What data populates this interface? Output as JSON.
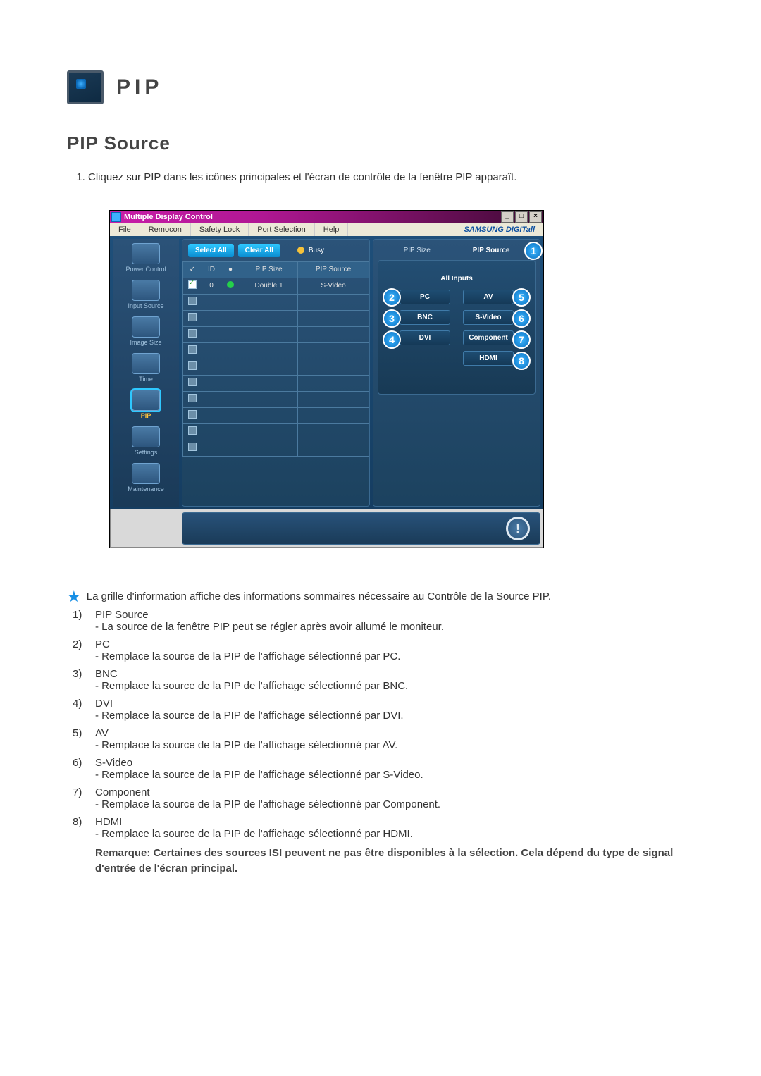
{
  "header": {
    "title": "PIP"
  },
  "section": {
    "subtitle": "PIP Source",
    "step1": "Cliquez sur PIP dans les icônes principales et l'écran de contrôle de la fenêtre PIP apparaît."
  },
  "app": {
    "title": "Multiple Display Control",
    "menus": [
      "File",
      "Remocon",
      "Safety Lock",
      "Port Selection",
      "Help"
    ],
    "brand": "SAMSUNG DIGITall",
    "sidebar": [
      {
        "label": "Power Control"
      },
      {
        "label": "Input Source"
      },
      {
        "label": "Image Size"
      },
      {
        "label": "Time"
      },
      {
        "label": "PIP"
      },
      {
        "label": "Settings"
      },
      {
        "label": "Maintenance"
      }
    ],
    "select_all": "Select All",
    "clear_all": "Clear All",
    "busy": "Busy",
    "grid_headers": {
      "chk": "✓",
      "id": "ID",
      "status": "●",
      "size": "PIP Size",
      "source": "PIP Source"
    },
    "grid_row0": {
      "id": "0",
      "size": "Double 1",
      "source": "S-Video"
    },
    "right": {
      "tab_size": "PIP Size",
      "tab_source": "PIP Source",
      "all_inputs": "All Inputs",
      "buttons": {
        "pc": "PC",
        "av": "AV",
        "bnc": "BNC",
        "svideo": "S-Video",
        "dvi": "DVI",
        "component": "Component",
        "hdmi": "HDMI"
      }
    },
    "info_icon": "!"
  },
  "star_line": "La grille d'information affiche des informations sommaires nécessaire au Contrôle de la Source PIP.",
  "items": [
    {
      "num": "1)",
      "label": "PIP Source",
      "body": "- La source de la fenêtre PIP peut se régler après avoir allumé le moniteur."
    },
    {
      "num": "2)",
      "label": "PC",
      "body": "- Remplace la source de la PIP de l'affichage sélectionné par PC."
    },
    {
      "num": "3)",
      "label": "BNC",
      "body": "- Remplace la source de la PIP de l'affichage sélectionné par BNC."
    },
    {
      "num": "4)",
      "label": "DVI",
      "body": "- Remplace la source de la PIP de l'affichage sélectionné par DVI."
    },
    {
      "num": "5)",
      "label": "AV",
      "body": "- Remplace la source de la PIP de l'affichage sélectionné par AV."
    },
    {
      "num": "6)",
      "label": "S-Video",
      "body": "- Remplace la source de la PIP de l'affichage sélectionné par S-Video."
    },
    {
      "num": "7)",
      "label": "Component",
      "body": "- Remplace la source de la PIP de l'affichage sélectionné par Component."
    },
    {
      "num": "8)",
      "label": "HDMI",
      "body": "- Remplace la source de la PIP de l'affichage sélectionné par HDMI."
    }
  ],
  "remark": "Remarque: Certaines des sources ISI peuvent ne pas être disponibles à la sélection. Cela dépend du type de signal d'entrée de l'écran principal."
}
